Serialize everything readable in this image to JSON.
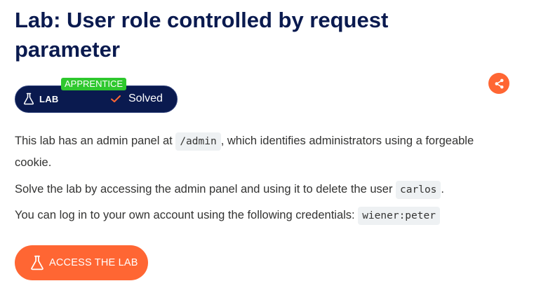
{
  "title": "Lab: User role controlled by request parameter",
  "badge": {
    "level": "APPRENTICE",
    "lab_label": "LAB",
    "status_label": "Solved",
    "lab_icon": "flask-icon",
    "status_icon": "check-icon"
  },
  "share_icon": "share-icon",
  "description": {
    "p1_before": "This lab has an admin panel at ",
    "p1_code": "/admin",
    "p1_after": ", which identifies administrators using a forgeable cookie.",
    "p2_before": "Solve the lab by accessing the admin panel and using it to delete the user ",
    "p2_code": "carlos",
    "p2_after": ".",
    "p3_before": "You can log in to your own account using the following credentials: ",
    "p3_code": "wiener:peter"
  },
  "access_button": {
    "label": "ACCESS THE LAB",
    "icon": "flask-icon"
  },
  "colors": {
    "title": "#0a1a4f",
    "pill_bg": "#0a1a4f",
    "accent": "#ff6633",
    "level_badge": "#2ec82e",
    "code_bg": "#eef1f3"
  }
}
